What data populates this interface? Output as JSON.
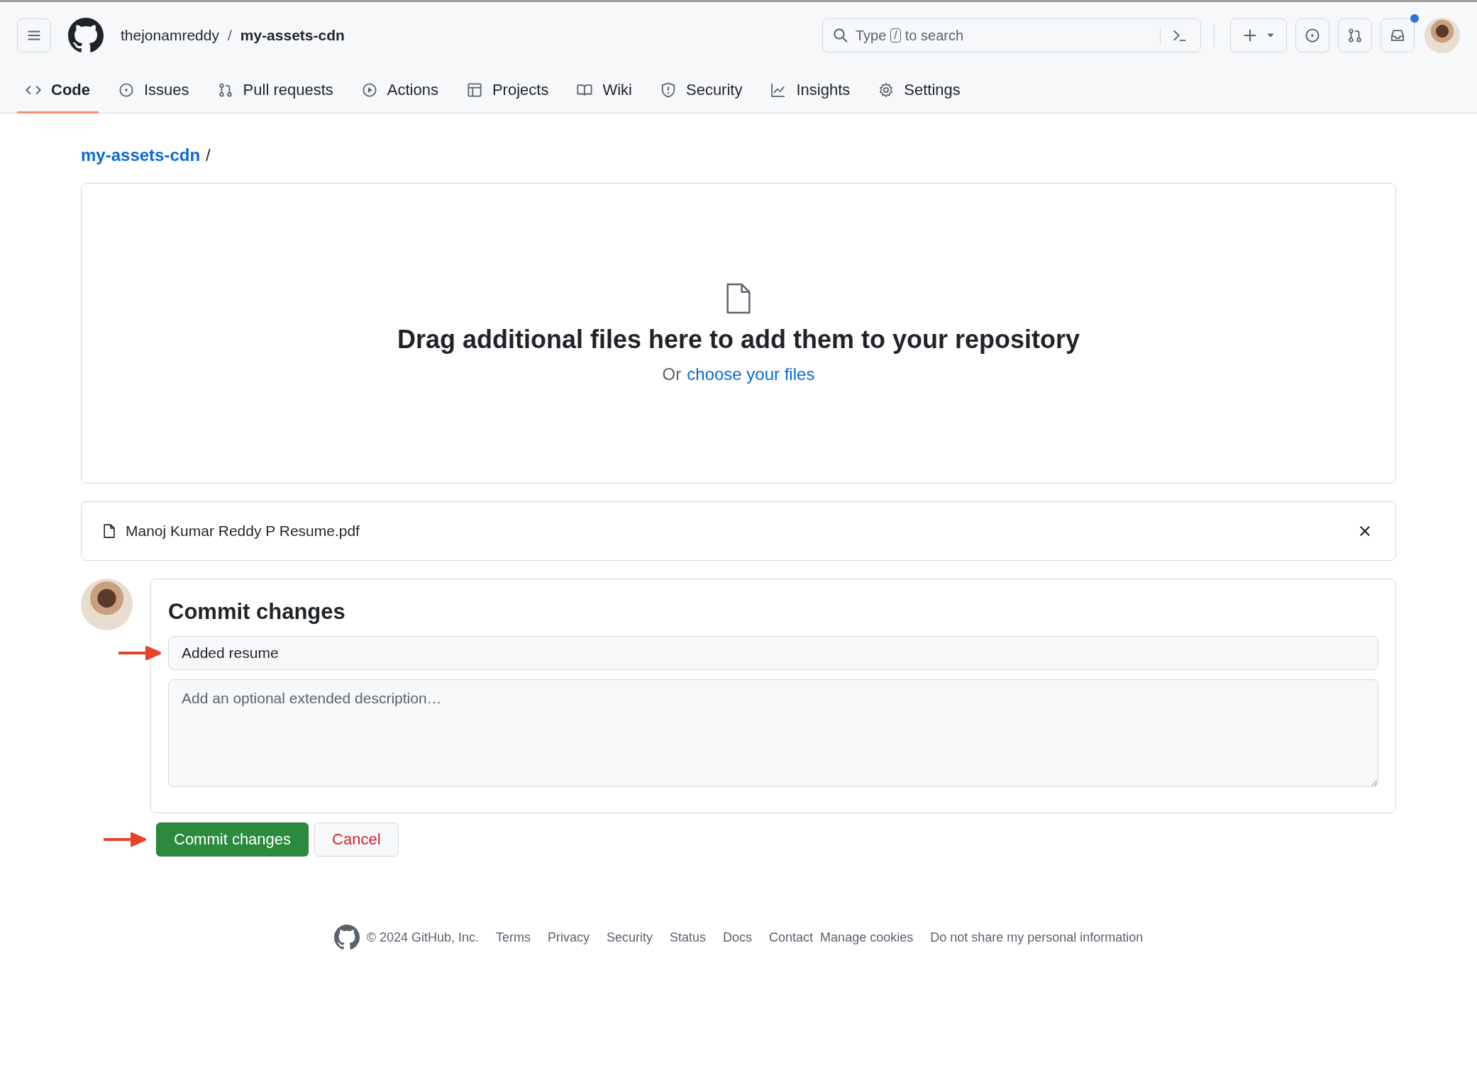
{
  "header": {
    "owner": "thejonamreddy",
    "separator": "/",
    "repo": "my-assets-cdn",
    "search": {
      "before": "Type",
      "key": "/",
      "after": "to search"
    },
    "notification_unread": true
  },
  "tabs": [
    {
      "label": "Code",
      "selected": true
    },
    {
      "label": "Issues",
      "selected": false
    },
    {
      "label": "Pull requests",
      "selected": false
    },
    {
      "label": "Actions",
      "selected": false
    },
    {
      "label": "Projects",
      "selected": false
    },
    {
      "label": "Wiki",
      "selected": false
    },
    {
      "label": "Security",
      "selected": false
    },
    {
      "label": "Insights",
      "selected": false
    },
    {
      "label": "Settings",
      "selected": false
    }
  ],
  "breadcrumb": {
    "repo": "my-assets-cdn",
    "separator": "/"
  },
  "dropzone": {
    "title": "Drag additional files here to add them to your repository",
    "prefix": "Or",
    "link": "choose your files"
  },
  "files": [
    {
      "name": "Manoj Kumar Reddy P Resume.pdf"
    }
  ],
  "commit": {
    "title": "Commit changes",
    "message": "Added resume",
    "description_placeholder": "Add an optional extended description…",
    "submit": "Commit changes",
    "cancel": "Cancel"
  },
  "footer": {
    "copyright": "© 2024 GitHub, Inc.",
    "links": [
      "Terms",
      "Privacy",
      "Security",
      "Status",
      "Docs",
      "Contact",
      "Manage cookies",
      "Do not share my personal information"
    ]
  }
}
